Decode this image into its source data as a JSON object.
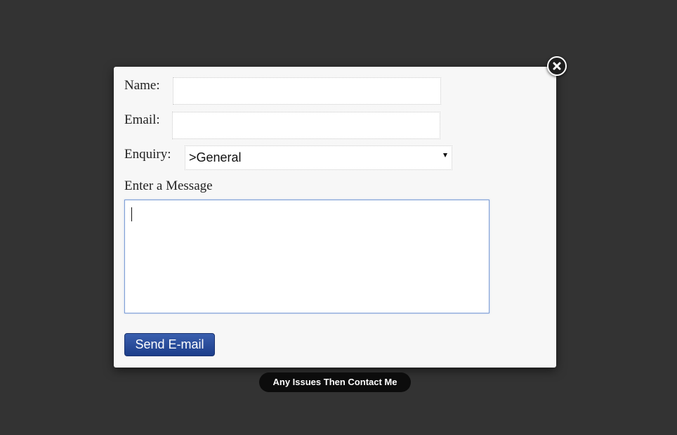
{
  "form": {
    "name_label": "Name:",
    "name_value": "",
    "email_label": "Email:",
    "email_value": "",
    "enquiry_label": "Enquiry:",
    "enquiry_selected": ">General",
    "message_label": "Enter a Message",
    "message_value": "",
    "send_label": "Send E-mail"
  },
  "close_icon": "close-x-icon",
  "footer": {
    "contact_label": "Any Issues Then Contact Me"
  },
  "colors": {
    "backdrop": "#333333",
    "modal_bg": "#f7f7f7",
    "send_button": "#1c3d8a",
    "pill_bg": "#0c0c0c"
  }
}
